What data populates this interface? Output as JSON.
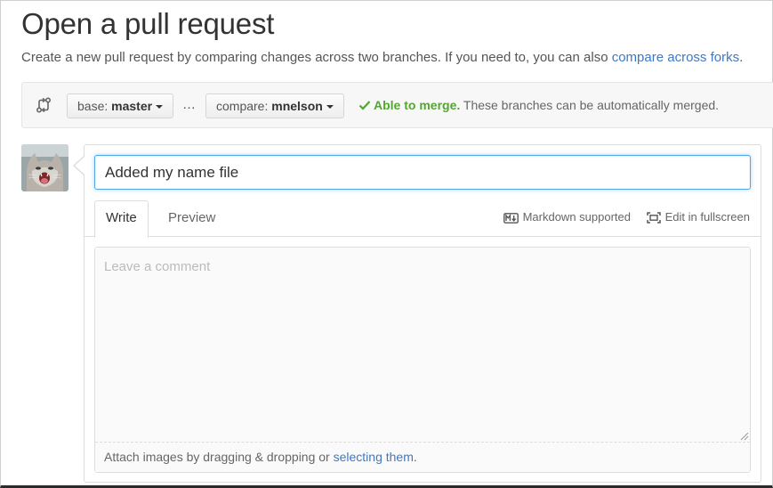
{
  "page": {
    "title": "Open a pull request",
    "subtitle_text": "Create a new pull request by comparing changes across two branches. If you need to, you can also ",
    "subtitle_link": "compare across forks",
    "subtitle_end": "."
  },
  "range": {
    "base_prefix": "base: ",
    "base_branch": "master",
    "ellipsis": "…",
    "compare_prefix": "compare: ",
    "compare_branch": "mnelson",
    "merge_ok": "Able to merge.",
    "merge_detail": " These branches can be automatically merged."
  },
  "form": {
    "title_value": "Added my name file",
    "tabs": [
      {
        "label": "Write",
        "active": true
      },
      {
        "label": "Preview",
        "active": false
      }
    ],
    "markdown_label": "Markdown supported",
    "fullscreen_label": "Edit in fullscreen",
    "comment_placeholder": "Leave a comment",
    "attach_text": "Attach images by dragging & dropping or ",
    "attach_link": "selecting them",
    "attach_end": "."
  },
  "colors": {
    "link": "#4078c0",
    "merge_ok": "#55a532",
    "focus_border": "#51a7e8"
  },
  "icons": {
    "compare": "git-compare-icon",
    "check": "check-icon",
    "markdown": "markdown-icon",
    "fullscreen": "fullscreen-icon",
    "avatar": "avatar-cat"
  }
}
